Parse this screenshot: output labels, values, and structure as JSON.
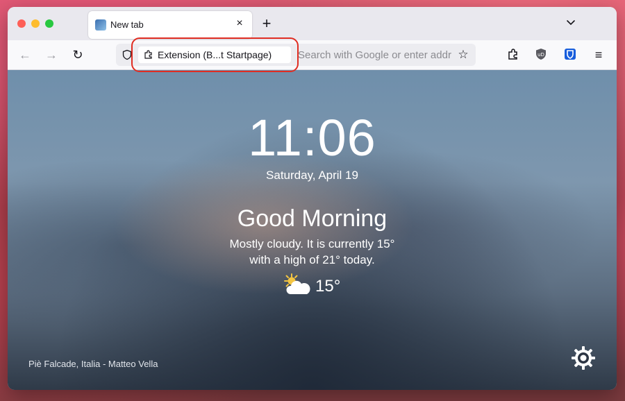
{
  "tab": {
    "title": "New tab",
    "close_symbol": "×"
  },
  "tabstrip": {
    "new_tab_symbol": "+",
    "tab_list_symbol": "⌄"
  },
  "navbar": {
    "back_symbol": "←",
    "forward_symbol": "→",
    "reload_symbol": "↻",
    "extension_chip_label": "Extension (B...t Startpage)",
    "url_placeholder": "Search with Google or enter addr",
    "bookmark_symbol": "☆",
    "menu_symbol": "≡"
  },
  "content": {
    "time": "11:06",
    "date": "Saturday, April 19",
    "greeting": "Good Morning",
    "summary_line1": "Mostly cloudy. It is currently 15°",
    "summary_line2": "with a high of 21° today.",
    "weather_temp": "15°",
    "photo_credit": "Piè Falcade, Italia - Matteo Vella"
  },
  "icons": {
    "weather": "partly-cloudy-icon",
    "settings": "gear-icon"
  },
  "colors": {
    "highlight_border": "#e02d22",
    "bitwarden_blue": "#175ddc",
    "ublock_gray": "#5a5a60"
  }
}
